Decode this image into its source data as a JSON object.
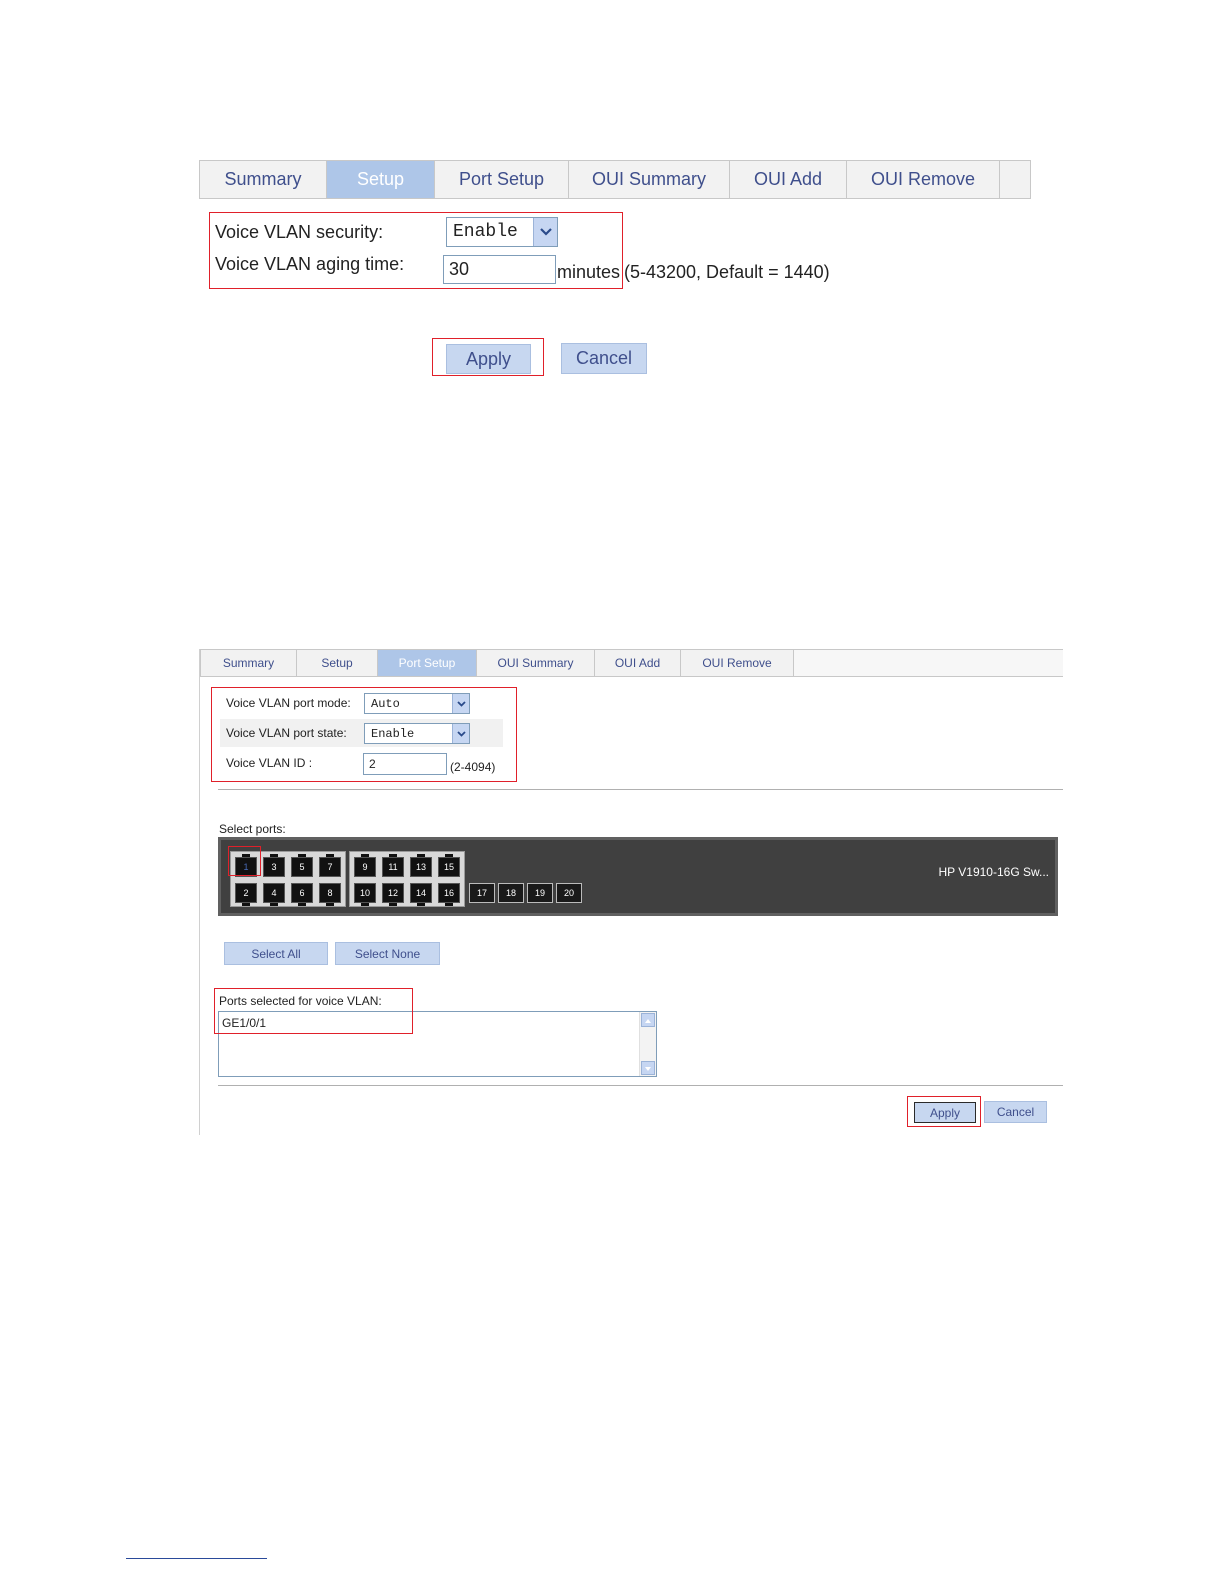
{
  "screen1": {
    "tabs": [
      "Summary",
      "Setup",
      "Port Setup",
      "OUI Summary",
      "OUI Add",
      "OUI Remove"
    ],
    "active_tab": "Setup",
    "security_label": "Voice VLAN security:",
    "security_value": "Enable",
    "aging_label": "Voice VLAN aging time:",
    "aging_value": "30",
    "aging_unit": "minutes",
    "aging_hint": "(5-43200, Default = 1440)",
    "apply_label": "Apply",
    "cancel_label": "Cancel"
  },
  "screen2": {
    "tabs": [
      "Summary",
      "Setup",
      "Port Setup",
      "OUI Summary",
      "OUI Add",
      "OUI Remove"
    ],
    "active_tab": "Port Setup",
    "port_mode_label": "Voice VLAN port mode:",
    "port_mode_value": "Auto",
    "port_state_label": "Voice VLAN port state:",
    "port_state_value": "Enable",
    "vlan_id_label": "Voice VLAN ID :",
    "vlan_id_value": "2",
    "vlan_id_hint": "(2-4094)",
    "select_ports_label": "Select ports:",
    "device_name": "HP V1910-16G Sw...",
    "ports_group1": [
      "1",
      "3",
      "5",
      "7",
      "2",
      "4",
      "6",
      "8"
    ],
    "ports_group2": [
      "9",
      "11",
      "13",
      "15",
      "10",
      "12",
      "14",
      "16"
    ],
    "sfp_ports": [
      "17",
      "18",
      "19",
      "20"
    ],
    "select_all_label": "Select All",
    "select_none_label": "Select None",
    "selected_ports_label": "Ports selected for voice VLAN:",
    "selected_ports_value": "GE1/0/1",
    "apply_label": "Apply",
    "cancel_label": "Cancel"
  }
}
